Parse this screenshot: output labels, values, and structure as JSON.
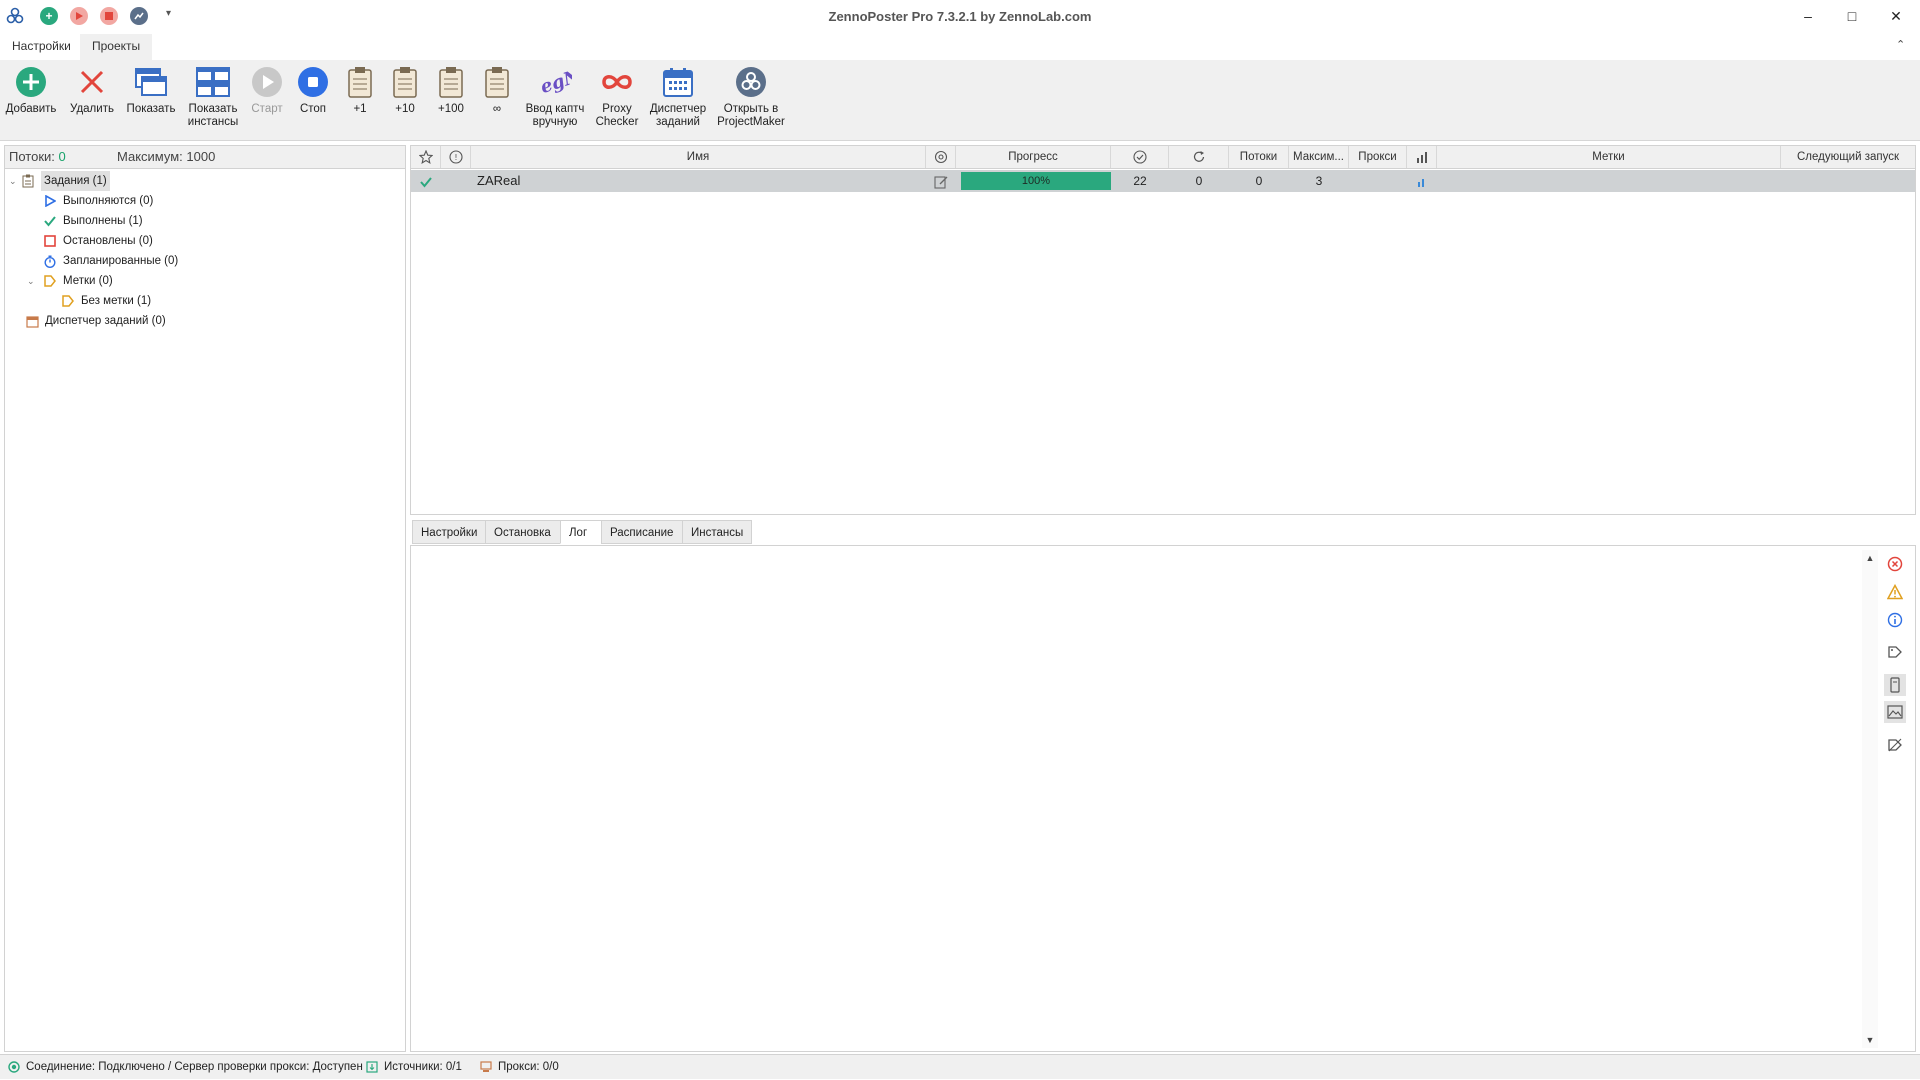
{
  "window": {
    "title": "ZennoPoster Pro 7.3.2.1 by ZennoLab.com",
    "minimize": "–",
    "maximize": "□",
    "close": "✕",
    "collapse": "⌃",
    "quick_access_dropdown": "▾"
  },
  "ribbon_tabs": [
    {
      "label": "Настройки"
    },
    {
      "label": "Проекты"
    }
  ],
  "toolbar": {
    "add": {
      "label": "Добавить",
      "icon": "add-icon"
    },
    "delete": {
      "label": "Удалить",
      "icon": "delete-icon"
    },
    "show": {
      "label": "Показать",
      "icon": "window-icon"
    },
    "show_instances": {
      "line1": "Показать",
      "line2": "инстансы",
      "icon": "instances-icon"
    },
    "start": {
      "label": "Старт",
      "icon": "play-icon"
    },
    "stop": {
      "label": "Стоп",
      "icon": "stop-icon"
    },
    "plus1": {
      "label": "+1",
      "icon": "clipboard-icon"
    },
    "plus10": {
      "label": "+10",
      "icon": "clipboard-icon"
    },
    "plus100": {
      "label": "+100",
      "icon": "clipboard-icon"
    },
    "infinite": {
      "label": "∞",
      "icon": "clipboard-icon"
    },
    "captcha": {
      "line1": "Ввод каптч",
      "line2": "вручную",
      "icon": "captcha-icon"
    },
    "proxy_checker": {
      "line1": "Proxy",
      "line2": "Checker",
      "icon": "infinity-icon"
    },
    "task_manager": {
      "line1": "Диспетчер",
      "line2": "заданий",
      "icon": "calendar-icon"
    },
    "open_pm": {
      "line1": "Открыть в",
      "line2": "ProjectMaker",
      "icon": "projectmaker-icon"
    }
  },
  "left_panel": {
    "threads_label": "Потоки:",
    "threads_value": "0",
    "max_label": "Максимум:",
    "max_value": "1000",
    "tree": [
      {
        "label": "Задания (1)"
      },
      {
        "label": "Выполняются (0)"
      },
      {
        "label": "Выполнены (1)"
      },
      {
        "label": "Остановлены (0)"
      },
      {
        "label": "Запланированные (0)"
      },
      {
        "label": "Метки (0)"
      },
      {
        "label": "Без метки (1)"
      },
      {
        "label": "Диспетчер заданий (0)"
      }
    ]
  },
  "grid": {
    "headers": {
      "name": "Имя",
      "progress": "Прогресс",
      "threads": "Потоки",
      "max": "Максим...",
      "proxy": "Прокси",
      "tags": "Метки",
      "next_run": "Следующий запуск"
    },
    "rows": [
      {
        "name": "ZAReal",
        "progress": 1.0,
        "progress_text": "100%",
        "success": "22",
        "retries": "0",
        "threads": "0",
        "max": "3",
        "proxy": "",
        "tags": "",
        "next_run": ""
      }
    ]
  },
  "bottom_tabs": [
    {
      "label": "Настройки"
    },
    {
      "label": "Остановка"
    },
    {
      "label": "Лог"
    },
    {
      "label": "Расписание"
    },
    {
      "label": "Инстансы"
    }
  ],
  "statusbar": {
    "connection": "Соединение: Подключено / Сервер проверки прокси: Доступен",
    "sources": "Источники: 0/1",
    "proxies": "Прокси: 0/0"
  },
  "colors": {
    "accent_green": "#2aa87e",
    "stop_blue": "#2f6fe4",
    "delete_red": "#e2453c",
    "row_selected": "#cfd2d4"
  }
}
